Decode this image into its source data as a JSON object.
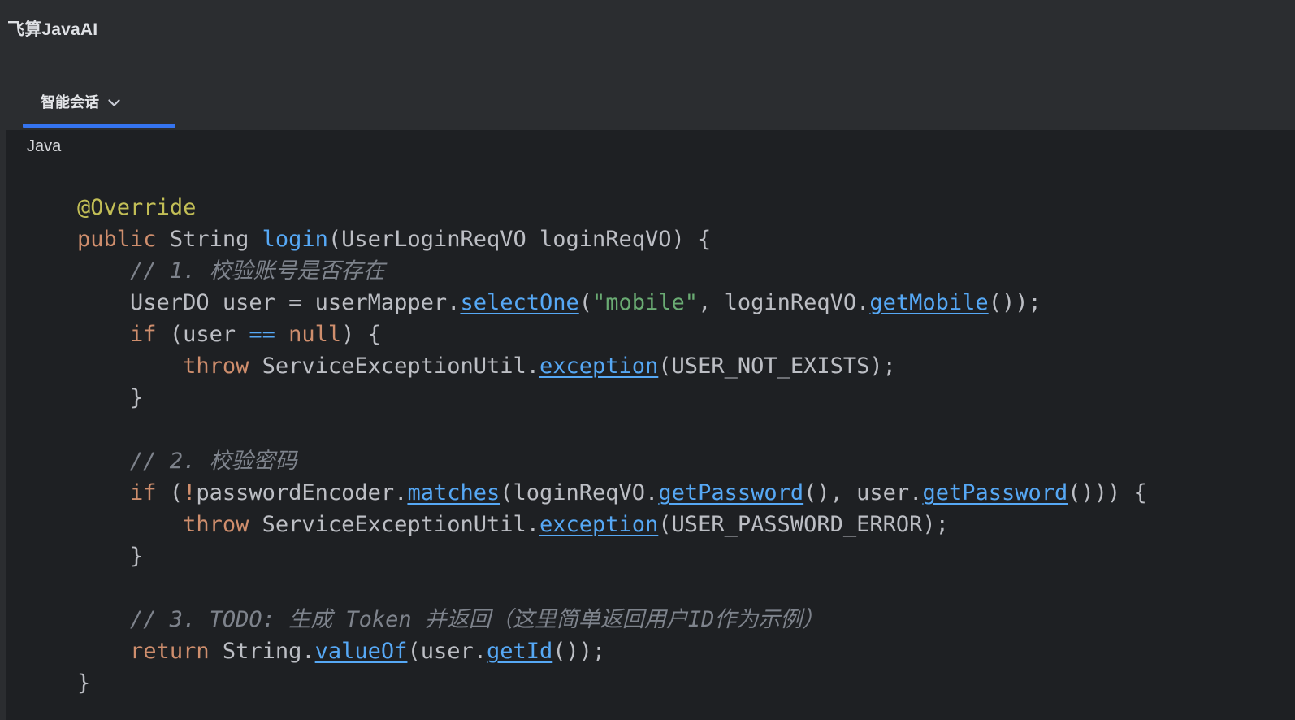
{
  "app": {
    "title": "飞算JavaAI"
  },
  "tabs": {
    "active": {
      "label": "智能会话",
      "icon": "chevron-down-icon"
    }
  },
  "code_block": {
    "language_label": "Java",
    "lines": [
      [
        {
          "s": "txt",
          "t": "    "
        },
        {
          "s": "meta",
          "t": "@Override"
        }
      ],
      [
        {
          "s": "txt",
          "t": "    "
        },
        {
          "s": "kw",
          "t": "public"
        },
        {
          "s": "txt",
          "t": " String "
        },
        {
          "s": "fn",
          "t": "login"
        },
        {
          "s": "txt",
          "t": "(UserLoginReqVO loginReqVO) {"
        }
      ],
      [
        {
          "s": "cmt",
          "t": "        // 1. 校验账号是否存在"
        }
      ],
      [
        {
          "s": "txt",
          "t": "        UserDO user = userMapper."
        },
        {
          "s": "mthu",
          "t": "selectOne"
        },
        {
          "s": "txt",
          "t": "("
        },
        {
          "s": "str",
          "t": "\"mobile\""
        },
        {
          "s": "txt",
          "t": ", loginReqVO."
        },
        {
          "s": "mthu",
          "t": "getMobile"
        },
        {
          "s": "txt",
          "t": "());"
        }
      ],
      [
        {
          "s": "txt",
          "t": "        "
        },
        {
          "s": "kw",
          "t": "if"
        },
        {
          "s": "txt",
          "t": " (user "
        },
        {
          "s": "op",
          "t": "=="
        },
        {
          "s": "txt",
          "t": " "
        },
        {
          "s": "kw",
          "t": "null"
        },
        {
          "s": "txt",
          "t": ") {"
        }
      ],
      [
        {
          "s": "txt",
          "t": "            "
        },
        {
          "s": "kw",
          "t": "throw"
        },
        {
          "s": "txt",
          "t": " ServiceExceptionUtil."
        },
        {
          "s": "mthu",
          "t": "exception"
        },
        {
          "s": "txt",
          "t": "(USER_NOT_EXISTS);"
        }
      ],
      [
        {
          "s": "txt",
          "t": "        }"
        }
      ],
      [],
      [
        {
          "s": "cmt",
          "t": "        // 2. 校验密码"
        }
      ],
      [
        {
          "s": "txt",
          "t": "        "
        },
        {
          "s": "kw",
          "t": "if"
        },
        {
          "s": "txt",
          "t": " ("
        },
        {
          "s": "kw",
          "t": "!"
        },
        {
          "s": "txt",
          "t": "passwordEncoder."
        },
        {
          "s": "mthu",
          "t": "matches"
        },
        {
          "s": "txt",
          "t": "(loginReqVO."
        },
        {
          "s": "mthu",
          "t": "getPassword"
        },
        {
          "s": "txt",
          "t": "(), user."
        },
        {
          "s": "mthu",
          "t": "getPassword"
        },
        {
          "s": "txt",
          "t": "())) {"
        }
      ],
      [
        {
          "s": "txt",
          "t": "            "
        },
        {
          "s": "kw",
          "t": "throw"
        },
        {
          "s": "txt",
          "t": " ServiceExceptionUtil."
        },
        {
          "s": "mthu",
          "t": "exception"
        },
        {
          "s": "txt",
          "t": "(USER_PASSWORD_ERROR);"
        }
      ],
      [
        {
          "s": "txt",
          "t": "        }"
        }
      ],
      [],
      [
        {
          "s": "cmt",
          "t": "        // 3. TODO: 生成 Token 并返回（这里简单返回用户ID作为示例）"
        }
      ],
      [
        {
          "s": "txt",
          "t": "        "
        },
        {
          "s": "kw",
          "t": "return"
        },
        {
          "s": "txt",
          "t": " String."
        },
        {
          "s": "mthu",
          "t": "valueOf"
        },
        {
          "s": "txt",
          "t": "(user."
        },
        {
          "s": "mthu",
          "t": "getId"
        },
        {
          "s": "txt",
          "t": "());"
        }
      ],
      [
        {
          "s": "txt",
          "t": "    }"
        }
      ]
    ]
  },
  "colors": {
    "header_bg": "#2b2d30",
    "code_bg": "#1e2023",
    "accent_blue": "#3574f0",
    "default_text": "#bcbec4",
    "keyword_orange": "#cf8e6d",
    "method_blue": "#56a8f5",
    "string_green": "#6aab73",
    "comment_gray": "#7e838c",
    "annotation_yellow": "#c2be56"
  }
}
